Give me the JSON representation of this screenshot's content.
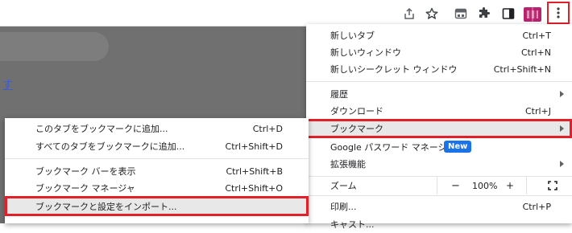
{
  "toolbar": {
    "icons": [
      "share-icon",
      "star-icon",
      "tab-search-icon",
      "extensions-icon",
      "side-panel-icon",
      "profile-avatar",
      "more-menu-icon"
    ]
  },
  "page": {
    "link_text": "す"
  },
  "main_menu": {
    "items": [
      {
        "label": "新しいタブ",
        "shortcut": "Ctrl+T"
      },
      {
        "label": "新しいウィンドウ",
        "shortcut": "Ctrl+N"
      },
      {
        "label": "新しいシークレット ウィンドウ",
        "shortcut": "Ctrl+Shift+N"
      },
      {
        "label": "履歴",
        "shortcut": ""
      },
      {
        "label": "ダウンロード",
        "shortcut": "Ctrl+J"
      },
      {
        "label": "ブックマーク",
        "shortcut": ""
      },
      {
        "label": "Google パスワード マネージャー",
        "badge": "New"
      },
      {
        "label": "拡張機能",
        "shortcut": ""
      },
      {
        "label": "ズーム",
        "zoom_minus": "−",
        "zoom_value": "100%",
        "zoom_plus": "+"
      },
      {
        "label": "印刷...",
        "shortcut": "Ctrl+P"
      },
      {
        "label": "キャスト...",
        "shortcut": ""
      }
    ]
  },
  "bookmark_submenu": {
    "items": [
      {
        "label": "このタブをブックマークに追加...",
        "shortcut": "Ctrl+D"
      },
      {
        "label": "すべてのタブをブックマークに追加...",
        "shortcut": "Ctrl+Shift+D"
      },
      {
        "label": "ブックマーク バーを表示",
        "shortcut": "Ctrl+Shift+B"
      },
      {
        "label": "ブックマーク マネージャ",
        "shortcut": "Ctrl+Shift+O"
      },
      {
        "label": "ブックマークと設定をインポート...",
        "shortcut": ""
      }
    ]
  },
  "colors": {
    "highlight_outline": "#e2202a",
    "new_badge": "#1a73e8",
    "dim_overlay": "#707070"
  }
}
